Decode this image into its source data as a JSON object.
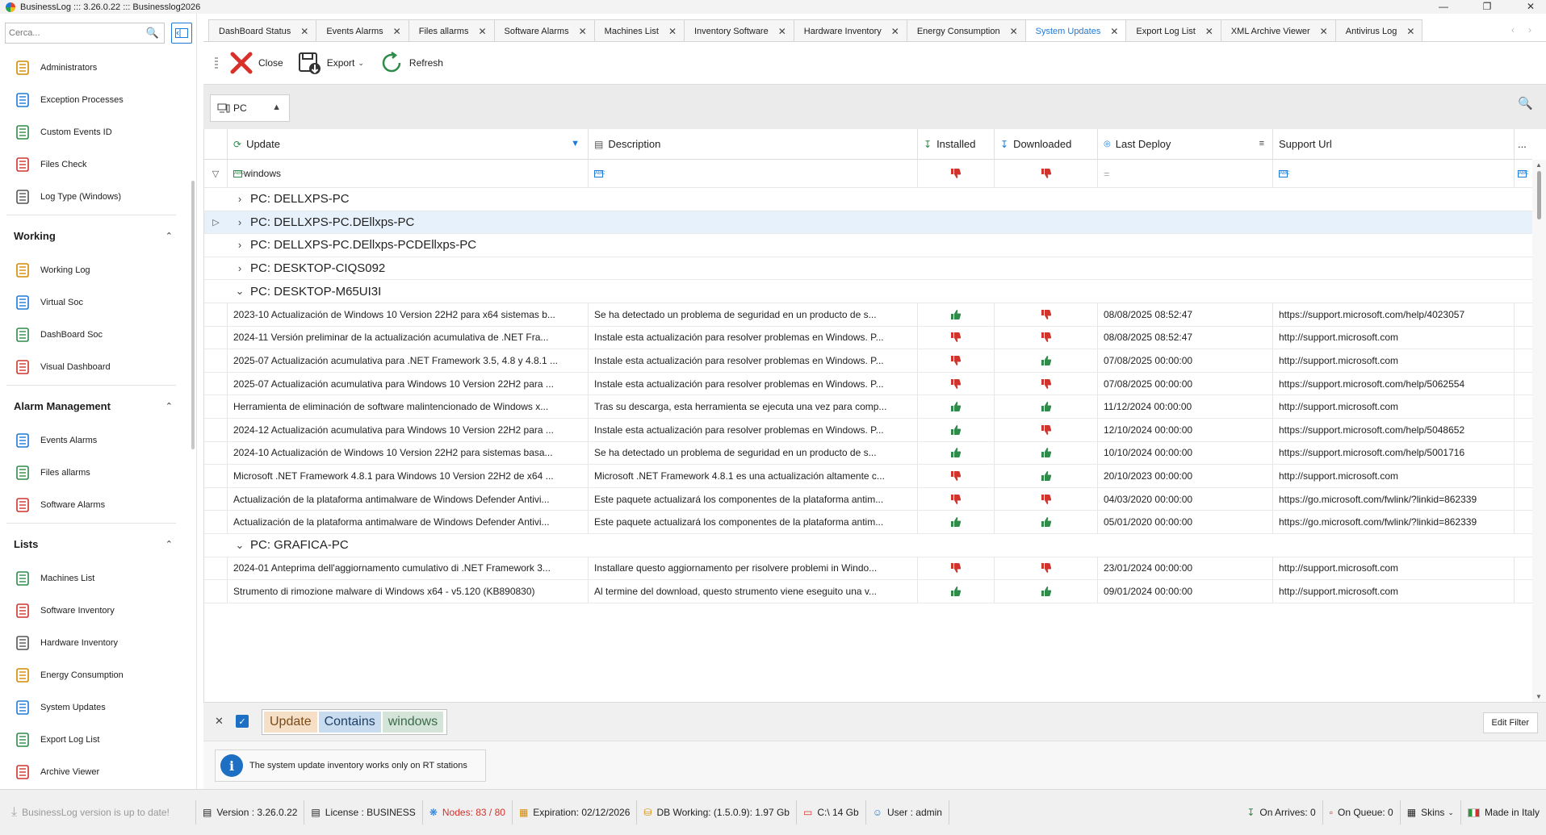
{
  "window": {
    "title": "BusinessLog ::: 3.26.0.22 ::: Businesslog2026",
    "controls": [
      "—",
      "❐",
      "✕"
    ]
  },
  "sidebar": {
    "search_placeholder": "Cerca...",
    "top_items": [
      {
        "label": "Administrators",
        "icon": "administrator-icon"
      },
      {
        "label": "Exception Processes",
        "icon": "checklist-icon"
      },
      {
        "label": "Custom Events ID",
        "icon": "custom-events-icon"
      },
      {
        "label": "Files Check",
        "icon": "file-check-icon"
      },
      {
        "label": "Log Type (Windows)",
        "icon": "log-type-icon"
      }
    ],
    "groups": [
      {
        "title": "Working",
        "items": [
          {
            "label": "Working Log",
            "icon": "working-log-icon"
          },
          {
            "label": "Virtual Soc",
            "icon": "virtual-soc-icon"
          },
          {
            "label": "DashBoard Soc",
            "icon": "dashboard-soc-icon"
          },
          {
            "label": "Visual Dashboard",
            "icon": "visual-dashboard-icon"
          }
        ]
      },
      {
        "title": "Alarm Management",
        "items": [
          {
            "label": "Events Alarms",
            "icon": "events-alarms-icon"
          },
          {
            "label": "Files allarms",
            "icon": "files-alarms-icon"
          },
          {
            "label": "Software Alarms",
            "icon": "software-alarms-icon"
          }
        ]
      },
      {
        "title": "Lists",
        "items": [
          {
            "label": "Machines List",
            "icon": "machines-list-icon"
          },
          {
            "label": "Software Inventory",
            "icon": "software-inventory-icon"
          },
          {
            "label": "Hardware Inventory",
            "icon": "hardware-inventory-icon"
          },
          {
            "label": "Energy Consumption",
            "icon": "energy-icon"
          },
          {
            "label": "System Updates",
            "icon": "system-updates-icon"
          },
          {
            "label": "Export Log List",
            "icon": "export-log-icon"
          },
          {
            "label": "Archive Viewer",
            "icon": "archive-viewer-icon"
          }
        ]
      }
    ]
  },
  "tabs": [
    {
      "label": "DashBoard Status",
      "active": false
    },
    {
      "label": "Events Alarms",
      "active": false
    },
    {
      "label": "Files allarms",
      "active": false
    },
    {
      "label": "Software Alarms",
      "active": false
    },
    {
      "label": "Machines List",
      "active": false
    },
    {
      "label": "Inventory Software",
      "active": false
    },
    {
      "label": "Hardware Inventory",
      "active": false
    },
    {
      "label": "Energy Consumption",
      "active": false
    },
    {
      "label": "System Updates",
      "active": true
    },
    {
      "label": "Export Log List",
      "active": false
    },
    {
      "label": "XML Archive Viewer",
      "active": false
    },
    {
      "label": "Antivirus Log",
      "active": false
    }
  ],
  "toolbar": {
    "close_label": "Close",
    "export_label": "Export",
    "refresh_label": "Refresh"
  },
  "grouping": {
    "chip_label": "PC"
  },
  "grid": {
    "columns": [
      "Update",
      "Description",
      "Installed",
      "Downloaded",
      "Last Deploy",
      "Support Url",
      "..."
    ],
    "filter_row": {
      "update": "windows",
      "last_deploy": "="
    },
    "rows": [
      {
        "type": "group",
        "label": "PC: DELLXPS-PC",
        "expanded": false
      },
      {
        "type": "group",
        "label": "PC: DELLXPS-PC.DEllxps-PC",
        "expanded": false,
        "focused": true
      },
      {
        "type": "group",
        "label": "PC: DELLXPS-PC.DEllxps-PCDEllxps-PC",
        "expanded": false
      },
      {
        "type": "group",
        "label": "PC: DESKTOP-CIQS092",
        "expanded": false
      },
      {
        "type": "group",
        "label": "PC: DESKTOP-M65UI3I",
        "expanded": true
      },
      {
        "type": "data",
        "update": "2023-10 Actualización de Windows 10 Version 22H2 para x64 sistemas b...",
        "description": "Se ha detectado un problema de seguridad en un producto de s...",
        "installed": true,
        "downloaded": false,
        "last_deploy": "08/08/2025 08:52:47",
        "support_url": "https://support.microsoft.com/help/4023057"
      },
      {
        "type": "data",
        "update": "2024-11 Versión preliminar de la actualización acumulativa de .NET Fra...",
        "description": "Instale esta actualización para resolver problemas en Windows. P...",
        "installed": false,
        "downloaded": false,
        "last_deploy": "08/08/2025 08:52:47",
        "support_url": "http://support.microsoft.com"
      },
      {
        "type": "data",
        "update": "2025-07 Actualización acumulativa para .NET Framework 3.5, 4.8 y 4.8.1 ...",
        "description": "Instale esta actualización para resolver problemas en Windows. P...",
        "installed": false,
        "downloaded": true,
        "last_deploy": "07/08/2025 00:00:00",
        "support_url": "http://support.microsoft.com"
      },
      {
        "type": "data",
        "update": "2025-07 Actualización acumulativa para Windows 10 Version 22H2 para ...",
        "description": "Instale esta actualización para resolver problemas en Windows. P...",
        "installed": false,
        "downloaded": false,
        "last_deploy": "07/08/2025 00:00:00",
        "support_url": "https://support.microsoft.com/help/5062554"
      },
      {
        "type": "data",
        "update": "Herramienta de eliminación de software malintencionado de Windows x...",
        "description": "Tras su descarga, esta herramienta se ejecuta una vez para comp...",
        "installed": true,
        "downloaded": true,
        "last_deploy": "11/12/2024 00:00:00",
        "support_url": "http://support.microsoft.com"
      },
      {
        "type": "data",
        "update": "2024-12 Actualización acumulativa para Windows 10 Version 22H2 para ...",
        "description": "Instale esta actualización para resolver problemas en Windows. P...",
        "installed": true,
        "downloaded": false,
        "last_deploy": "12/10/2024 00:00:00",
        "support_url": "https://support.microsoft.com/help/5048652"
      },
      {
        "type": "data",
        "update": "2024-10 Actualización de Windows 10 Version 22H2 para sistemas basa...",
        "description": "Se ha detectado un problema de seguridad en un producto de s...",
        "installed": true,
        "downloaded": true,
        "last_deploy": "10/10/2024 00:00:00",
        "support_url": "https://support.microsoft.com/help/5001716"
      },
      {
        "type": "data",
        "update": "Microsoft .NET Framework 4.8.1 para Windows 10 Version 22H2 de x64 ...",
        "description": "Microsoft .NET Framework 4.8.1 es una actualización altamente c...",
        "installed": false,
        "downloaded": true,
        "last_deploy": "20/10/2023 00:00:00",
        "support_url": "http://support.microsoft.com"
      },
      {
        "type": "data",
        "update": "Actualización de la plataforma antimalware de Windows Defender Antivi...",
        "description": "Este paquete actualizará los componentes de la plataforma antim...",
        "installed": false,
        "downloaded": false,
        "last_deploy": "04/03/2020 00:00:00",
        "support_url": "https://go.microsoft.com/fwlink/?linkid=862339"
      },
      {
        "type": "data",
        "update": "Actualización de la plataforma antimalware de Windows Defender Antivi...",
        "description": "Este paquete actualizará los componentes de la plataforma antim...",
        "installed": true,
        "downloaded": true,
        "last_deploy": "05/01/2020 00:00:00",
        "support_url": "https://go.microsoft.com/fwlink/?linkid=862339"
      },
      {
        "type": "group",
        "label": "PC: GRAFICA-PC",
        "expanded": true
      },
      {
        "type": "data",
        "update": "2024-01 Anteprima dell'aggiornamento cumulativo di .NET Framework 3...",
        "description": "Installare questo aggiornamento per risolvere problemi in Windo...",
        "installed": false,
        "downloaded": false,
        "last_deploy": "23/01/2024 00:00:00",
        "support_url": "http://support.microsoft.com"
      },
      {
        "type": "data",
        "update": "Strumento di rimozione malware di Windows x64 - v5.120 (KB890830)",
        "description": "Al termine del download, questo strumento viene eseguito una v...",
        "installed": true,
        "downloaded": true,
        "last_deploy": "09/01/2024 00:00:00",
        "support_url": "http://support.microsoft.com"
      }
    ]
  },
  "filter_panel": {
    "tokens": [
      "Update",
      "Contains",
      "windows"
    ],
    "edit_label": "Edit Filter"
  },
  "info": {
    "text": "The system update inventory works only on RT stations"
  },
  "statusbar": {
    "update_status": "BusinessLog version is up to date!",
    "version": "Version : 3.26.0.22",
    "license": "License : BUSINESS",
    "nodes": "Nodes: 83 / 80",
    "expiration": "Expiration: 02/12/2026",
    "db": "DB Working: (1.5.0.9): 1.97 Gb",
    "disk": "C:\\ 14 Gb",
    "user": "User : admin",
    "on_arrives": "On Arrives: 0",
    "on_queue": "On Queue: 0",
    "skins": "Skins",
    "made_in": "Made in Italy"
  },
  "colors": {
    "accent": "#1d7ad9",
    "thumb_up": "#2e8b4a",
    "thumb_down": "#d0342c",
    "focus_row": "#e7f1fb"
  }
}
